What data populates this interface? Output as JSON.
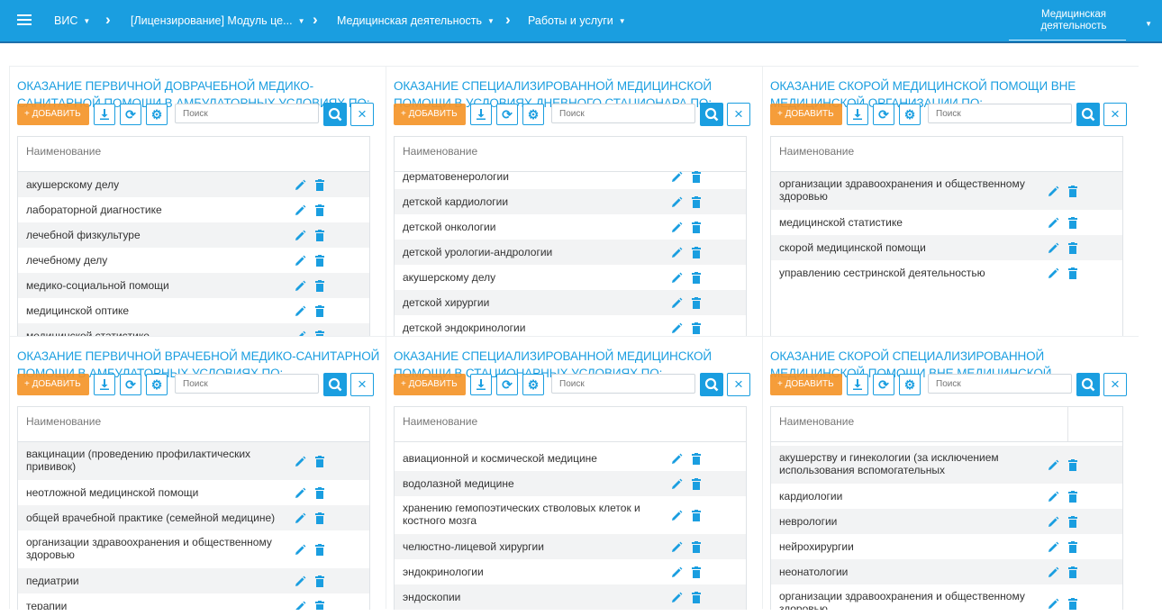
{
  "topbar": {
    "app": "ВИС",
    "crumbs": [
      {
        "label": "[Лицензирование] Модуль це..."
      },
      {
        "label": "Медицинская деятельность"
      },
      {
        "label": "Работы и услуги"
      }
    ],
    "right_select": "Медицинская деятельность"
  },
  "common": {
    "add_label": "+ ДОБАВИТЬ",
    "search_placeholder": "Поиск",
    "column_header": "Наименование"
  },
  "colors": {
    "primary": "#1a9ee0",
    "accent": "#f5952a"
  },
  "panels": [
    {
      "title": "Оказание первичной доврачебной медико-санитарной помощи в амбулаторных условиях по:",
      "rows": [
        "акушерскому делу",
        "лабораторной диагностике",
        "лечебной физкультуре",
        "лечебному делу",
        "медико-социальной помощи",
        "медицинской оптике",
        "медицинской статистике"
      ]
    },
    {
      "title": "Оказание специализированной медицинской помощи в условиях дневного стационара по:",
      "rows": [
        "дерматовенерологии",
        "детской кардиологии",
        "детской онкологии",
        "детской урологии-андрологии",
        "акушерскому делу",
        "детской хирургии",
        "детской эндокринологии"
      ]
    },
    {
      "title": "Оказание скорой медицинской помощи вне медицинской организации по:",
      "rows": [
        "организации здравоохранения и общественному здоровью",
        "медицинской статистике",
        "скорой медицинской помощи",
        "управлению сестринской деятельностью"
      ]
    },
    {
      "title": "Оказание первичной врачебной медико-санитарной помощи в амбулаторных условиях по:",
      "rows": [
        "вакцинации (проведению профилактических прививок)",
        "неотложной медицинской помощи",
        "общей врачебной практике (семейной медицине)",
        "организации здравоохранения и общественному здоровью",
        "педиатрии",
        "терапии"
      ]
    },
    {
      "title": "Оказание специализированной медицинской помощи в стационарных условиях по:",
      "rows": [
        "авиационной и космической медицине",
        "водолазной медицине",
        "хранению гемопоэтических стволовых клеток и костного мозга",
        "челюстно-лицевой хирургии",
        "эндокринологии",
        "эндоскопии"
      ]
    },
    {
      "title": "Оказание скорой специализированной медицинской помощи вне медицинской",
      "rows": [
        "акушерству и гинекологии (за исключением использования вспомогательных",
        "кардиологии",
        "неврологии",
        "нейрохирургии",
        "неонатологии",
        "организации здравоохранения и общественному здоровью"
      ]
    }
  ]
}
